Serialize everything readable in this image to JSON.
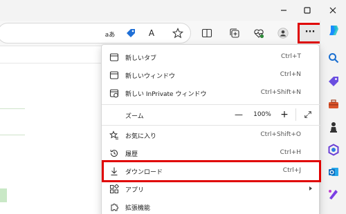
{
  "window": {
    "minimize_label": "minimize",
    "maximize_label": "maximize",
    "close_label": "close"
  },
  "toolbar": {
    "read_aloud_glyph": "A",
    "translate_glyph": "aあ",
    "more_glyph": "···"
  },
  "menu": {
    "new_tab": {
      "label": "新しいタブ",
      "shortcut": "Ctrl+T"
    },
    "new_window": {
      "label": "新しいウィンドウ",
      "shortcut": "Ctrl+N"
    },
    "new_inprivate": {
      "label": "新しい InPrivate ウィンドウ",
      "shortcut": "Ctrl+Shift+N"
    },
    "zoom": {
      "label": "ズーム",
      "minus": "—",
      "value": "100%",
      "plus": "+"
    },
    "favorites": {
      "label": "お気に入り",
      "shortcut": "Ctrl+Shift+O"
    },
    "history": {
      "label": "履歴",
      "shortcut": "Ctrl+H"
    },
    "downloads": {
      "label": "ダウンロード",
      "shortcut": "Ctrl+J"
    },
    "apps": {
      "label": "アプリ"
    },
    "extensions": {
      "label": "拡張機能"
    }
  },
  "colors": {
    "highlight": "#e00000",
    "accent": "#0078d4"
  }
}
